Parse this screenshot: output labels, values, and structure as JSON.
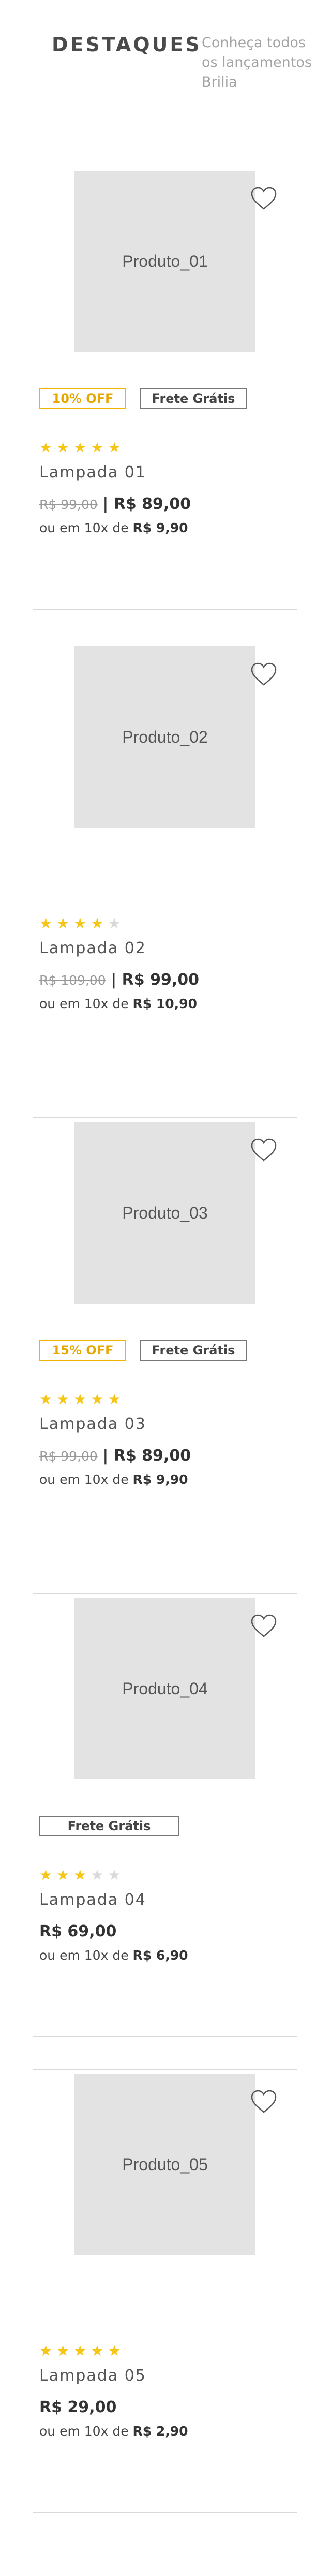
{
  "header": {
    "title": "DESTAQUES",
    "subtitle": "Conheça todos os lançamentos Brilia"
  },
  "colors": {
    "star_on": "#f5c518",
    "star_off": "#d9d9d9",
    "discount_tag": "#e6a700",
    "image_placeholder": "#e3e3e3"
  },
  "products": [
    {
      "image_label": "Produto_01",
      "discount": "10% OFF",
      "shipping": "Frete Grátis",
      "rating": 5,
      "name": "Lampada 01",
      "old_price": "R$ 99,00",
      "separator": "|",
      "price": "R$ 89,00",
      "installments_prefix": "ou em 10x de",
      "installments_value": "R$ 9,90"
    },
    {
      "image_label": "Produto_02",
      "discount": "",
      "shipping": "",
      "rating": 4,
      "name": "Lampada 02",
      "old_price": "R$ 109,00",
      "separator": "|",
      "price": "R$ 99,00",
      "installments_prefix": "ou em 10x de",
      "installments_value": "R$ 10,90"
    },
    {
      "image_label": "Produto_03",
      "discount": "15% OFF",
      "shipping": "Frete Grátis",
      "rating": 5,
      "name": "Lampada 03",
      "old_price": "R$ 99,00",
      "separator": "|",
      "price": "R$ 89,00",
      "installments_prefix": "ou em 10x de",
      "installments_value": "R$ 9,90"
    },
    {
      "image_label": "Produto_04",
      "discount": "",
      "shipping": "Frete Grátis",
      "rating": 3,
      "name": "Lampada 04",
      "old_price": "",
      "separator": "",
      "price": "R$ 69,00",
      "installments_prefix": "ou em 10x de",
      "installments_value": "R$ 6,90"
    },
    {
      "image_label": "Produto_05",
      "discount": "",
      "shipping": "",
      "rating": 5,
      "name": "Lampada 05",
      "old_price": "",
      "separator": "",
      "price": "R$ 29,00",
      "installments_prefix": "ou em 10x de",
      "installments_value": "R$ 2,90"
    }
  ]
}
